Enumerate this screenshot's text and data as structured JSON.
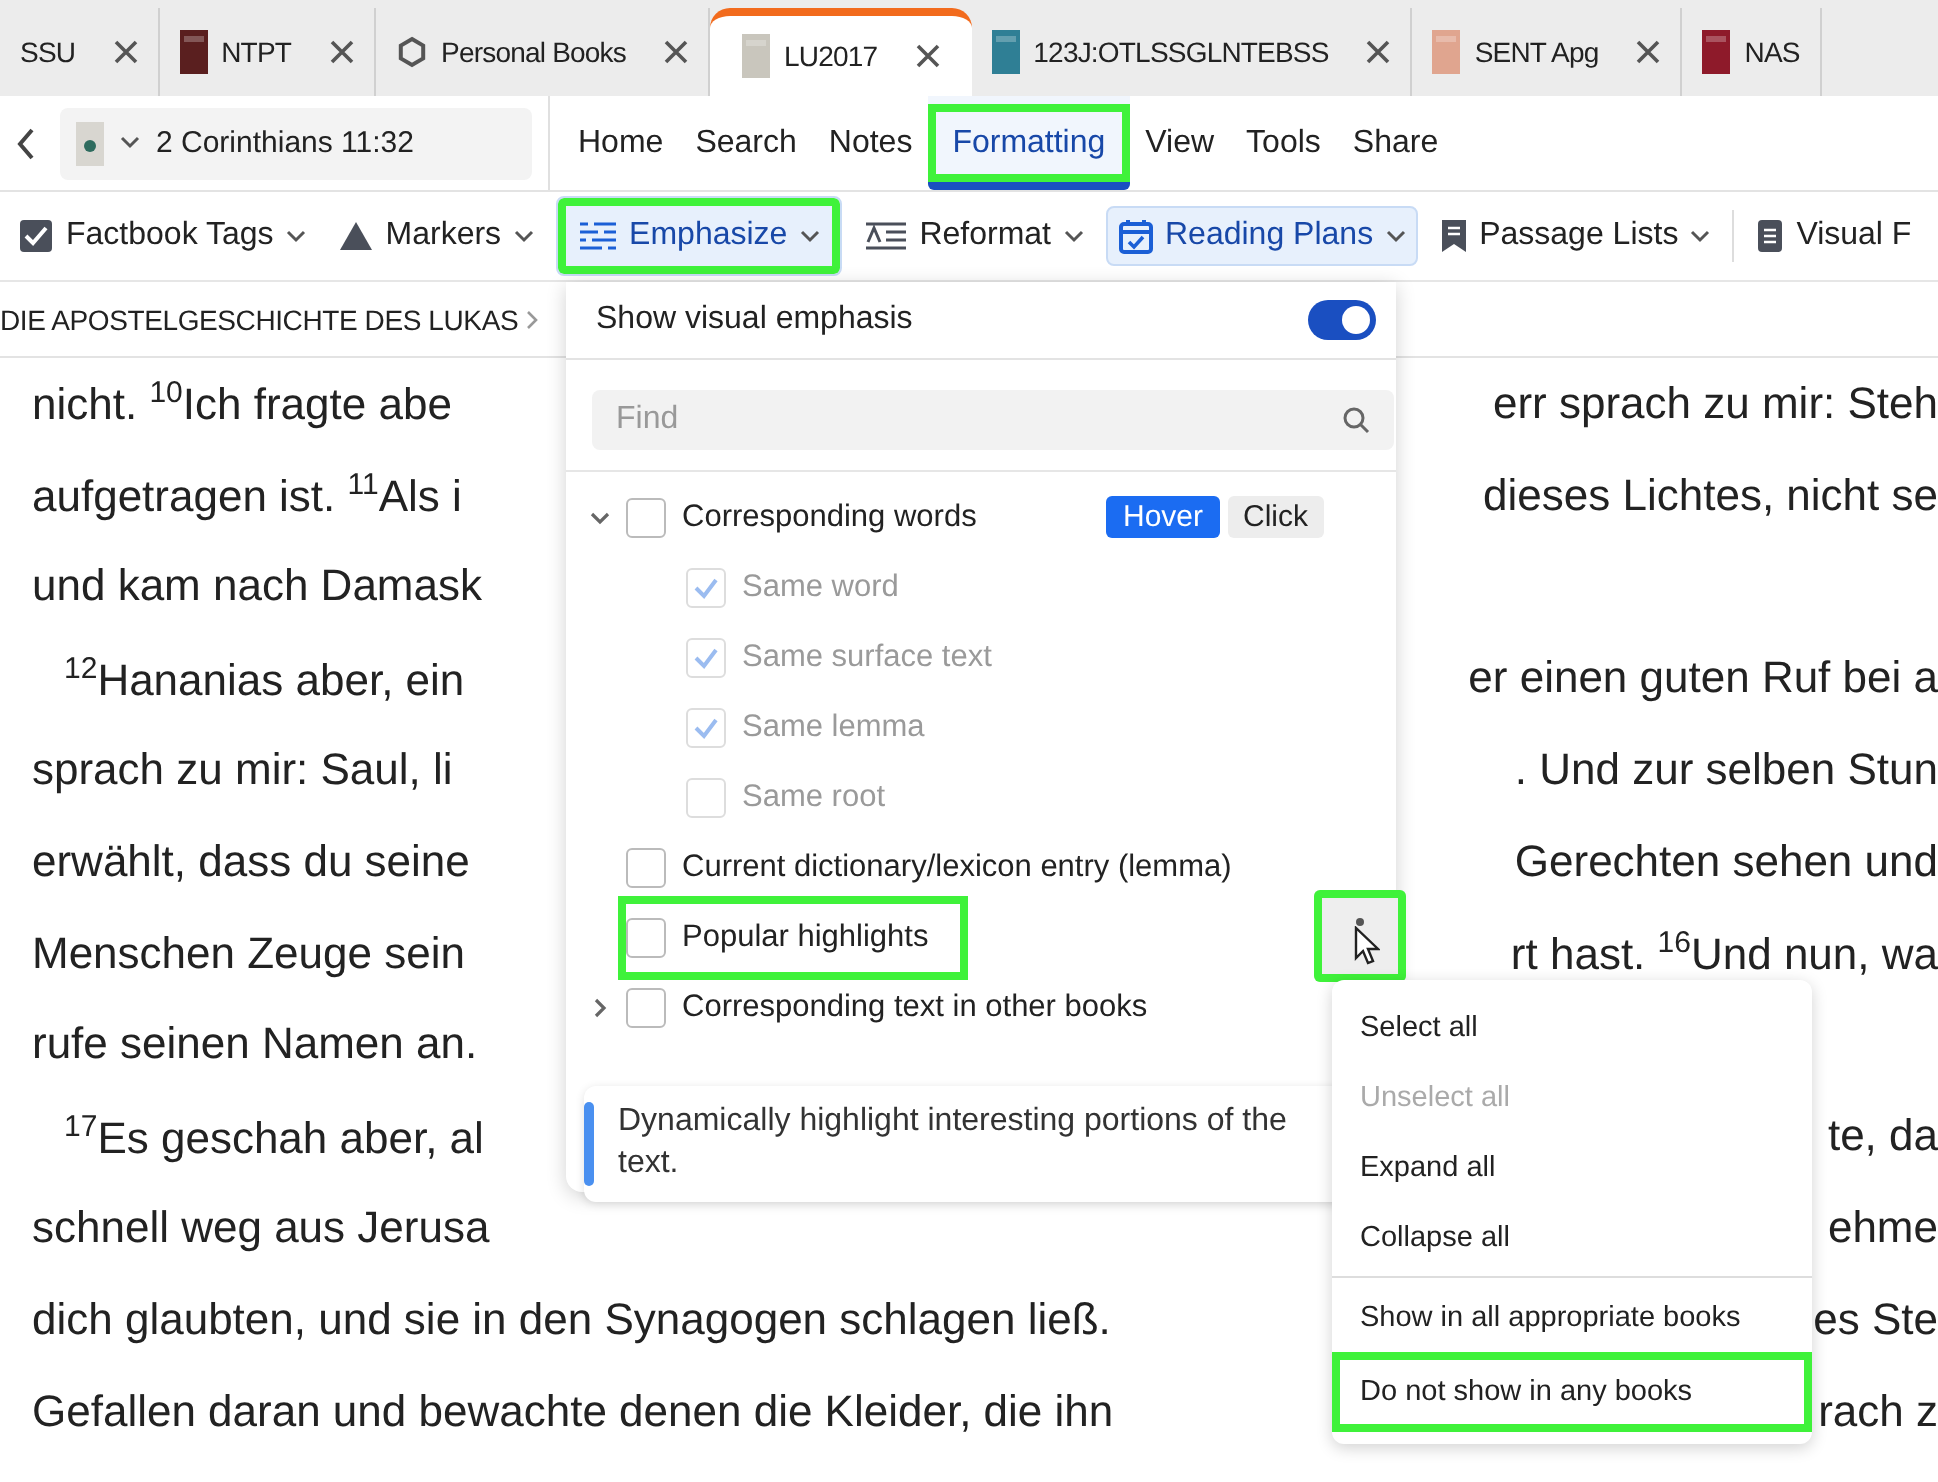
{
  "tabs": [
    {
      "label": "SSU",
      "selected": false,
      "closable": true
    },
    {
      "label": "NTPT",
      "selected": false,
      "closable": true,
      "kind": "cover",
      "color": "#5a1f1f"
    },
    {
      "label": "Personal Books",
      "selected": false,
      "closable": true,
      "kind": "hexagon"
    },
    {
      "label": "LU2017",
      "selected": true,
      "closable": true,
      "kind": "cover",
      "color": "#c9c6bd"
    },
    {
      "label": "123J:OTLSSGLNTEBSS",
      "selected": false,
      "closable": true,
      "kind": "cover",
      "color": "#2f7f95"
    },
    {
      "label": "SENT Apg",
      "selected": false,
      "closable": true,
      "kind": "cover",
      "color": "#e0a58f"
    },
    {
      "label": "NAS",
      "selected": false,
      "closable": false,
      "kind": "cover",
      "color": "#8e1a2a"
    }
  ],
  "reference": {
    "value": "2 Corinthians 11:32"
  },
  "menu": [
    {
      "label": "Home",
      "selected": false,
      "highlighted": false
    },
    {
      "label": "Search",
      "selected": false,
      "highlighted": false
    },
    {
      "label": "Notes",
      "selected": false,
      "highlighted": false
    },
    {
      "label": "Formatting",
      "selected": true,
      "highlighted": true
    },
    {
      "label": "View",
      "selected": false,
      "highlighted": false
    },
    {
      "label": "Tools",
      "selected": false,
      "highlighted": false
    },
    {
      "label": "Share",
      "selected": false,
      "highlighted": false
    }
  ],
  "toolbar": [
    {
      "label": "Factbook Tags",
      "selected": false,
      "highlighted": false,
      "dropdown": true
    },
    {
      "label": "Markers",
      "selected": false,
      "highlighted": false,
      "dropdown": true
    },
    {
      "label": "Emphasize",
      "selected": true,
      "highlighted": true,
      "dropdown": true
    },
    {
      "label": "Reformat",
      "selected": false,
      "highlighted": false,
      "dropdown": true
    },
    {
      "label": "Reading Plans",
      "selected": true,
      "highlighted": false,
      "dropdown": true
    },
    {
      "label": "Passage Lists",
      "selected": false,
      "highlighted": false,
      "dropdown": true
    },
    {
      "label": "Visual F",
      "selected": false,
      "highlighted": false,
      "dropdown": false
    }
  ],
  "breadcrumb": "DIE APOSTELGESCHICHTE DES LUKAS",
  "lines": [
    {
      "indent": false,
      "left": "nicht. $^{10}$Ich fragte abe",
      "right": "err sprach zu mir: Steh"
    },
    {
      "indent": false,
      "left": "aufgetragen ist. $^{11}$Als i",
      "right": "dieses Lichtes, nicht se"
    },
    {
      "indent": false,
      "left": "und kam nach Damask"
    },
    {
      "indent": true,
      "left": "$^{12}$Hananias aber, ein",
      "right": "er einen guten Ruf bei a"
    },
    {
      "indent": false,
      "left": "sprach zu mir: Saul, li",
      "right": ". Und zur selben Stun"
    },
    {
      "indent": false,
      "left": "erwählt, dass du seine",
      "right": "Gerechten sehen und"
    },
    {
      "indent": false,
      "left": "Menschen Zeuge sein",
      "right": "rt hast. $^{16}$Und nun, wa"
    },
    {
      "indent": false,
      "left": "rufe seinen Namen an."
    },
    {
      "indent": true,
      "left": "$^{17}$Es geschah aber, al",
      "right": "te, da"
    },
    {
      "indent": false,
      "left": "schnell weg aus Jerusa",
      "right": "ehme"
    },
    {
      "indent": false,
      "left": "dich glaubten, und sie in den Synagogen schlagen ließ.",
      "right": "es Ste"
    },
    {
      "indent": false,
      "left": "Gefallen daran und bewachte denen die Kleider, die ihn",
      "right": "rach z"
    }
  ],
  "popup": {
    "toggle": {
      "label": "Show visual emphasis",
      "on": true
    },
    "search": {
      "placeholder": "Find"
    },
    "items": [
      {
        "label": "Corresponding words",
        "checked": false,
        "disabled": false,
        "highlighted": false,
        "expanded": true,
        "modes": [
          {
            "label": "Hover",
            "selected": true
          },
          {
            "label": "Click",
            "selected": false
          }
        ],
        "children": [
          {
            "label": "Same word",
            "checked": true,
            "disabled": true,
            "highlighted": false
          },
          {
            "label": "Same surface text",
            "checked": true,
            "disabled": true,
            "highlighted": false
          },
          {
            "label": "Same lemma",
            "checked": true,
            "disabled": true,
            "highlighted": false
          },
          {
            "label": "Same root",
            "checked": false,
            "disabled": true,
            "highlighted": false
          }
        ]
      },
      {
        "label": "Current dictionary/lexicon entry (lemma)",
        "checked": false,
        "disabled": false,
        "highlighted": false
      },
      {
        "label": "Popular highlights",
        "checked": false,
        "disabled": false,
        "highlighted": true
      },
      {
        "label": "Corresponding text in other books",
        "checked": false,
        "disabled": false,
        "highlighted": false,
        "expanded": false
      }
    ],
    "note": "Dynamically highlight interesting portions of the text."
  },
  "more_button": {
    "highlighted": true
  },
  "context_menu": {
    "groups": [
      {
        "items": [
          {
            "label": "Select all",
            "disabled": false,
            "highlighted": false
          },
          {
            "label": "Unselect all",
            "disabled": true,
            "highlighted": false
          },
          {
            "label": "Expand all",
            "disabled": false,
            "highlighted": false
          },
          {
            "label": "Collapse all",
            "disabled": false,
            "highlighted": false
          }
        ]
      },
      {
        "items": [
          {
            "label": "Show in all appropriate books",
            "disabled": false,
            "highlighted": false
          },
          {
            "label": "Do not show in any books",
            "disabled": false,
            "highlighted": true
          }
        ]
      }
    ]
  }
}
